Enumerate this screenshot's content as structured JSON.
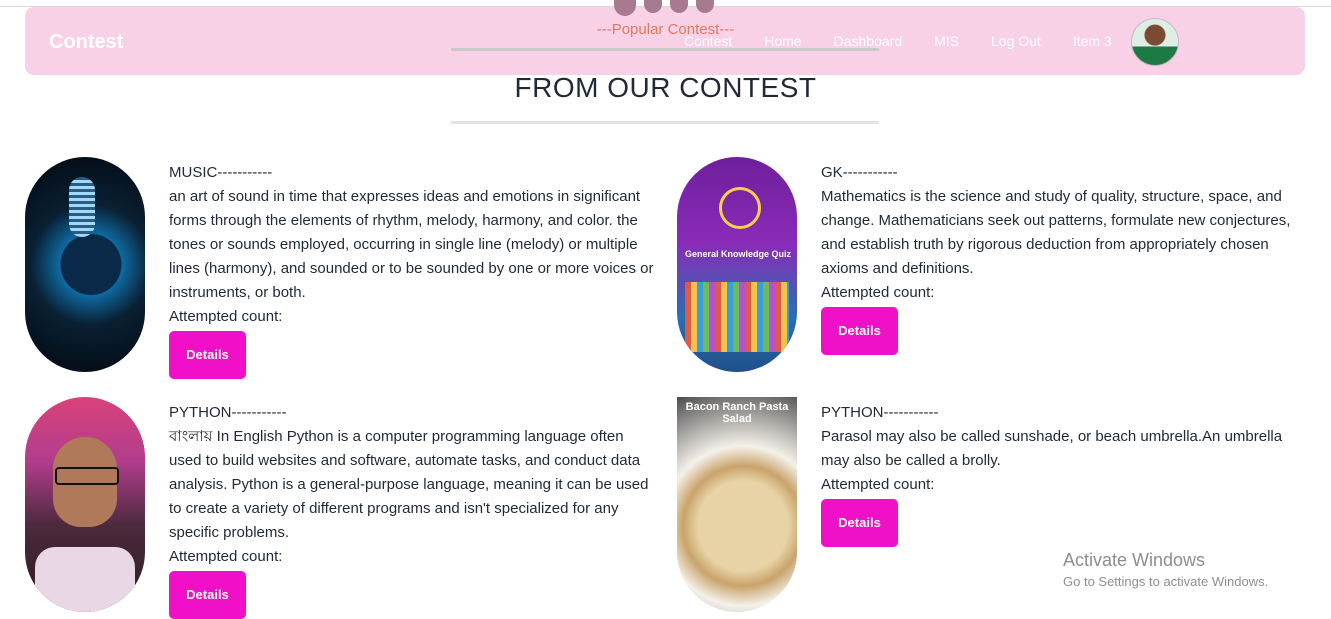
{
  "navbar": {
    "brand": "Contest",
    "links": [
      "Contest",
      "Home",
      "Dashboard",
      "MIS",
      "Log Out",
      "Item 3"
    ]
  },
  "section": {
    "subtitle": "---Popular Contest---",
    "title": "FROM OUR CONTEST"
  },
  "cards": [
    {
      "name": "MUSIC-----------",
      "description": "an art of sound in time that expresses ideas and emotions in significant forms through the elements of rhythm, melody, harmony, and color. the tones or sounds employed, occurring in single line (melody) or multiple lines (harmony), and sounded or to be sounded by one or more voices or instruments, or both.",
      "attempted_label": "Attempted count:",
      "button": "Details",
      "image": "microphone-image"
    },
    {
      "name": "GK-----------",
      "description": "Mathematics is the science and study of quality, structure, space, and change. Mathematicians seek out patterns, formulate new conjectures, and establish truth by rigorous deduction from appropriately chosen axioms and definitions.",
      "attempted_label": "Attempted count:",
      "button": "Details",
      "image": "general-knowledge-quiz-image",
      "image_text": "General Knowledge Quiz"
    },
    {
      "name": "PYTHON-----------",
      "description": "বাংলায় In English Python is a computer programming language often used to build websites and software, automate tasks, and conduct data analysis. Python is a general-purpose language, meaning it can be used to create a variety of different programs and isn't specialized for any specific problems.",
      "attempted_label": "Attempted count:",
      "button": "Details",
      "image": "person-portrait-image"
    },
    {
      "name": "PYTHON-----------",
      "description": "Parasol may also be called sunshade, or beach umbrella.An umbrella may also be called a brolly.",
      "attempted_label": "Attempted count:",
      "button": "Details",
      "image": "pasta-salad-image",
      "image_text": "Bacon Ranch Pasta Salad"
    }
  ],
  "watermark": {
    "line1": "Activate Windows",
    "line2": "Go to Settings to activate Windows."
  },
  "colors": {
    "navbar_bg": "#f9d1e6",
    "button_bg": "#ef10c8",
    "subtitle": "#e07a5f"
  }
}
